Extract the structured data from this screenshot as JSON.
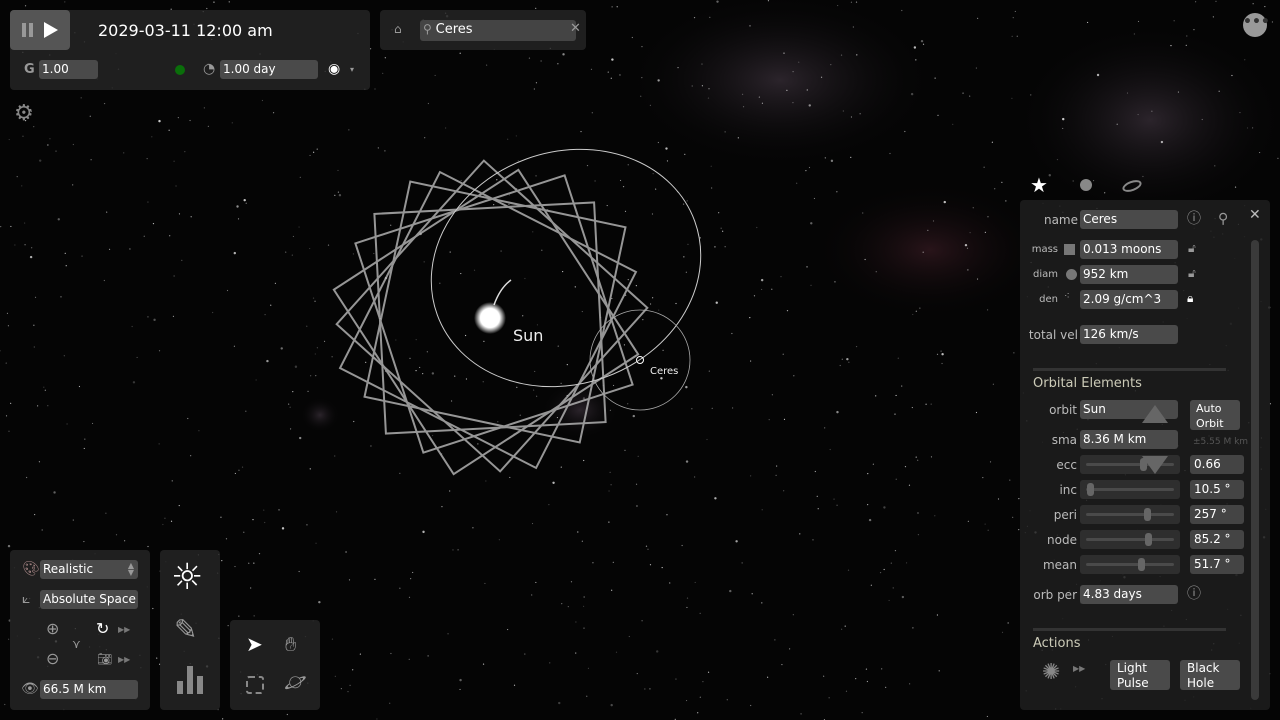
{
  "top_bar": {
    "datetime": "2029-03-11 12:00 am",
    "g_label": "G",
    "gravity": "1.00",
    "timestep": "1.00 day",
    "status_color": "#0a6e0a"
  },
  "search": {
    "value": "Ceres"
  },
  "scene": {
    "sun_label": "Sun",
    "body_label": "Ceres"
  },
  "panel": {
    "tabs": [
      "star-tab",
      "sphere-tab",
      "orbit-tab"
    ],
    "name_label": "name",
    "name": "Ceres",
    "mass_label": "mass",
    "mass": "0.013 moons",
    "diam_label": "diam",
    "diam": "952 km",
    "den_label": "den",
    "den": "2.09 g/cm^3",
    "vel_label": "total vel",
    "vel": "126 km/s",
    "orbital_title": "Orbital Elements",
    "orbit_label": "orbit",
    "orbit": "Sun",
    "auto_orbit": "Auto Orbit",
    "sma_label": "sma",
    "sma": "8.36 M km",
    "sma_hint": "±5.55 M km",
    "elements": [
      {
        "label": "ecc",
        "value": "0.66",
        "fraction": 0.66
      },
      {
        "label": "inc",
        "value": "10.5 °",
        "fraction": 0.0
      },
      {
        "label": "peri",
        "value": "257 °",
        "fraction": 0.71
      },
      {
        "label": "node",
        "value": "85.2 °",
        "fraction": 0.73
      },
      {
        "label": "mean",
        "value": "51.7 °",
        "fraction": 0.64
      }
    ],
    "orb_per_label": "orb per",
    "orb_per": "4.83 days",
    "actions_title": "Actions",
    "light_pulse": "Light Pulse",
    "black_hole": "Black Hole"
  },
  "bottom": {
    "view_mode": "Realistic",
    "frame": "Absolute Space",
    "view_distance": "66.5 M km"
  }
}
